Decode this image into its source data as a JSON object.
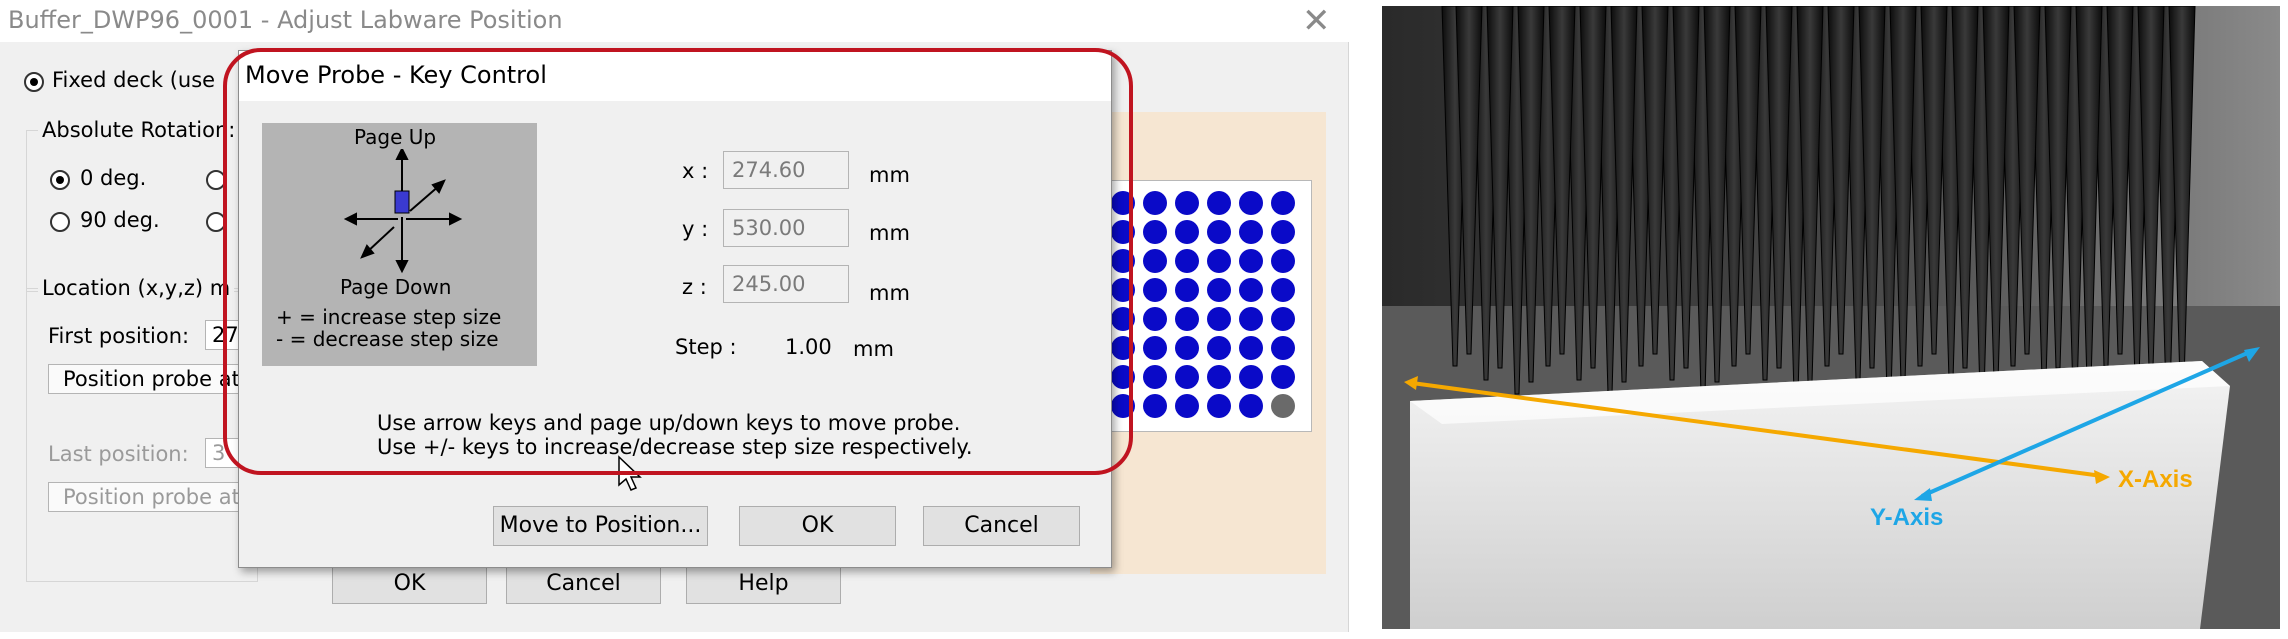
{
  "main_window": {
    "title": "Buffer_DWP96_0001 - Adjust Labware Position",
    "close_glyph": "✕",
    "fixed_deck_label": "Fixed deck (use",
    "rotation_label": "Absolute Rotation:",
    "rot_0_label": "0 deg.",
    "rot_90_label": "90 deg.",
    "location_label": "Location (x,y,z) m",
    "first_position_label": "First position:",
    "first_position_value": "27",
    "position_probe_1": "Position probe at",
    "last_position_label": "Last position:",
    "last_position_value": "3",
    "position_probe_2": "Position probe at",
    "ok_label": "OK",
    "cancel_label": "Cancel",
    "help_label": "Help"
  },
  "dialog": {
    "title": "Move Probe - Key Control",
    "page_up": "Page Up",
    "page_down": "Page Down",
    "plus_hint": "+ = increase step size",
    "minus_hint": "- = decrease step size",
    "x_label": "x :",
    "x_value": "274.60",
    "y_label": "y :",
    "y_value": "530.00",
    "z_label": "z :",
    "z_value": "245.00",
    "unit": "mm",
    "step_label": "Step :",
    "step_value": "1.00",
    "instruction_1": "Use arrow keys and page up/down keys to move probe.",
    "instruction_2": "Use +/- keys to increase/decrease step size respectively.",
    "move_button": "Move to Position...",
    "ok_button": "OK",
    "cancel_button": "Cancel"
  },
  "plate": {
    "well_color": "#0a0ac8",
    "last_well_color": "#6a6a6a"
  },
  "photo": {
    "x_axis_label": "X-Axis",
    "y_axis_label": "Y-Axis",
    "x_axis_color": "#f5a800",
    "y_axis_color": "#1ea6e6"
  },
  "accent": {
    "highlight_color": "#c01420"
  }
}
